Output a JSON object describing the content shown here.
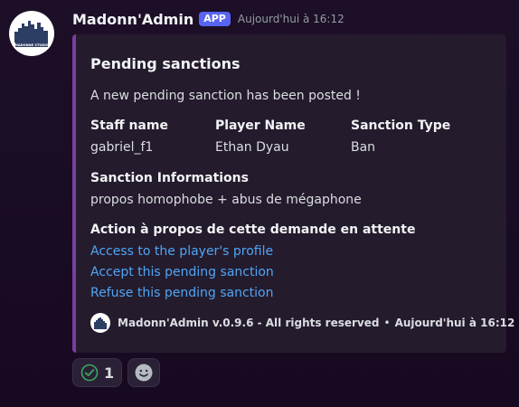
{
  "message": {
    "author": "Madonn'Admin",
    "badge": "APP",
    "timestamp": "Aujourd'hui à 16:12",
    "avatar_icon": "city-skyline-logo-icon",
    "logo_text": "MADONNE STUDIO"
  },
  "embed": {
    "accent_color": "#7a3ea1",
    "title": "Pending sanctions",
    "description": "A new pending sanction has been posted !",
    "fields": [
      {
        "name": "Staff name",
        "value": "gabriel_f1"
      },
      {
        "name": "Player Name",
        "value": "Ethan Dyau"
      },
      {
        "name": "Sanction Type",
        "value": "Ban"
      },
      {
        "name": "Sanction Informations",
        "value": "propos homophobe + abus de mégaphone"
      },
      {
        "name": "Action à propos de cette demande en attente"
      }
    ],
    "links": [
      "Access to the player's profile",
      "Accept this pending sanction",
      "Refuse this pending sanction"
    ],
    "link_color": "#4fa6f5",
    "footer": {
      "text": "Madonn'Admin v.0.9.6 - All rights reserved",
      "separator": "•",
      "timestamp": "Aujourd'hui à 16:12"
    }
  },
  "reactions": [
    {
      "icon": "check-circle-icon",
      "count": "1"
    },
    {
      "icon": "add-reaction-smiley-icon"
    }
  ],
  "colors": {
    "badge": "#5865f2",
    "reaction_check": "#3ba55d"
  }
}
